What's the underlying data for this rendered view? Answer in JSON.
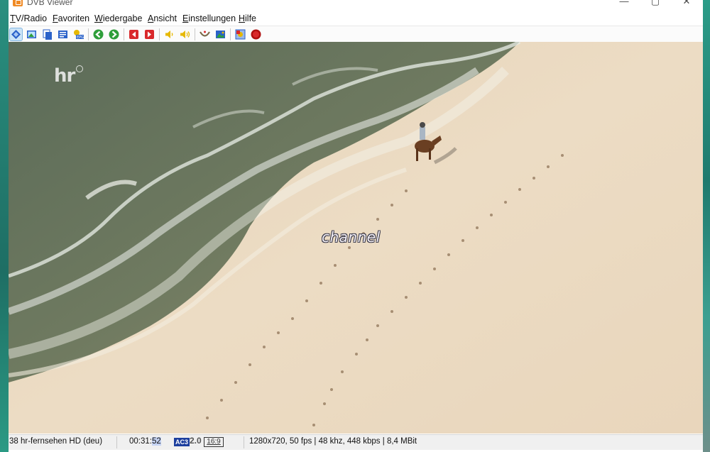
{
  "window": {
    "title": "DVB Viewer"
  },
  "menu": [
    {
      "accel": "T",
      "rest": "V/Radio"
    },
    {
      "accel": "F",
      "rest": "avoriten"
    },
    {
      "accel": "W",
      "rest": "iedergabe"
    },
    {
      "accel": "A",
      "rest": "nsicht"
    },
    {
      "accel": "E",
      "rest": "instellungen"
    },
    {
      "accel": "H",
      "rest": "ilfe"
    }
  ],
  "toolbar": {
    "icons": [
      "tv-radio-icon",
      "picture-icon",
      "copy-window-icon",
      "teletext-icon",
      "epg-icon",
      "back-icon",
      "forward-icon",
      "prev-channel-icon",
      "next-channel-icon",
      "volume-down-icon",
      "volume-up-icon",
      "mute-icon",
      "screenshot-icon",
      "settings-icon",
      "record-icon"
    ],
    "colors": {
      "active_bg": "#cce4f7",
      "green": "#2e9e3a",
      "red": "#d9292b",
      "yellow": "#e6b800",
      "blue": "#2b62c9"
    }
  },
  "video": {
    "osd_text": "channel",
    "logo": "hr"
  },
  "status": {
    "channel": "38 hr-fernsehen HD (deu)",
    "time_prefix": "00:31:",
    "time_highlight": "52",
    "audio_badge": "AC3",
    "audio_channels": "2.0",
    "aspect": "16:9",
    "stream_info": "1280x720, 50 fps | 48 khz, 448 kbps | 8,4 MBit"
  }
}
